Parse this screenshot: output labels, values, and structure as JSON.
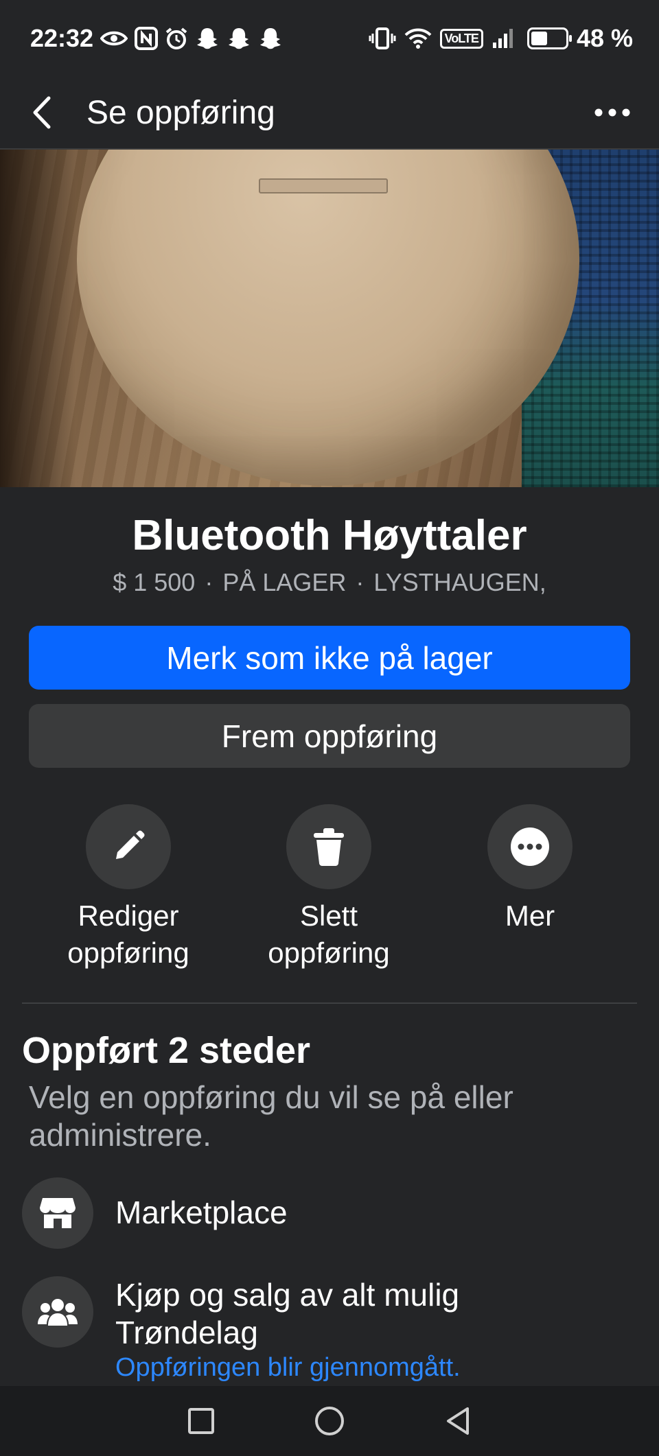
{
  "status_bar": {
    "time": "22:32",
    "battery": "48 %",
    "battery_level": 0.48,
    "network_badge": "VoLTE",
    "left_icons": [
      "eye-icon",
      "nfc-icon",
      "alarm-icon",
      "snapchat-icon",
      "snapchat-icon",
      "snapchat-icon"
    ],
    "right_icons": [
      "vibrate-icon",
      "wifi-icon",
      "volte-icon",
      "signal-icon",
      "battery-icon"
    ]
  },
  "header": {
    "title": "Se oppføring",
    "back_icon": "chevron-left-icon",
    "more_icon": "more-horizontal-icon"
  },
  "photo": {
    "pages": 2,
    "current_page": 1
  },
  "listing": {
    "title": "Bluetooth Høyttaler",
    "price": "$ 1 500",
    "separator": "·",
    "status": "PÅ LAGER",
    "location": "LYSTHAUGEN,"
  },
  "buttons": {
    "primary": "Merk som ikke på lager",
    "secondary": "Frem oppføring"
  },
  "actions": [
    {
      "label": "Rediger oppføring",
      "icon": "pencil-icon"
    },
    {
      "label": "Slett oppføring",
      "icon": "trash-icon"
    },
    {
      "label": "Mer",
      "icon": "more-icon"
    }
  ],
  "placements": {
    "title": "Oppført 2 steder",
    "description": "Velg en oppføring du vil se på eller administrere.",
    "items": [
      {
        "name": "Marketplace",
        "icon": "store-icon",
        "status": ""
      },
      {
        "name": "Kjøp og salg av alt mulig Trøndelag",
        "icon": "group-icon",
        "status": "Oppføringen blir gjennomgått."
      }
    ]
  },
  "nav_bar": {
    "icons": [
      "recent-apps-icon",
      "home-icon",
      "back-icon"
    ]
  },
  "colors": {
    "background": "#242527",
    "primary_button": "#0866ff",
    "secondary_button": "#3a3b3c",
    "link": "#2d88ff",
    "muted_text": "#b0b3b8"
  }
}
